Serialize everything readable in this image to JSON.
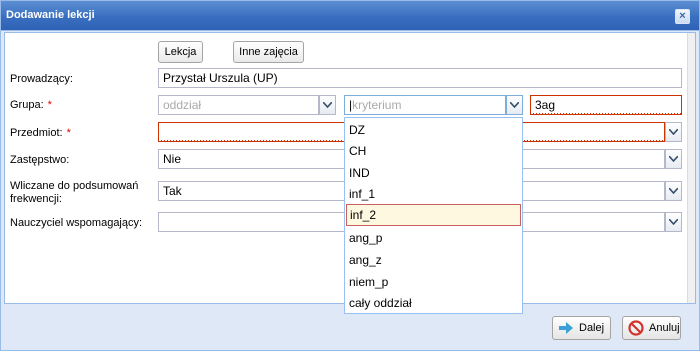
{
  "window": {
    "title": "Dodawanie lekcji",
    "close_glyph": "×"
  },
  "tabs": [
    {
      "label": "Lekcja"
    },
    {
      "label": "Inne zajęcia"
    }
  ],
  "form": {
    "prowadzacy": {
      "label": "Prowadzący:",
      "value": "Przystał Urszula (UP)"
    },
    "grupa": {
      "label": "Grupa:",
      "required": "*",
      "oddzial_placeholder": "oddział",
      "kryterium_placeholder": "kryterium",
      "value": "3ag"
    },
    "przedmiot": {
      "label": "Przedmiot:",
      "required": "*",
      "value": ""
    },
    "zastepstwo": {
      "label": "Zastępstwo:",
      "value": "Nie"
    },
    "frekwencja": {
      "label_line1": "Wliczane do podsumowań",
      "label_line2": "frekwencji:",
      "value": "Tak"
    },
    "wspomagajacy": {
      "label": "Nauczyciel wspomagający:",
      "value": ""
    }
  },
  "dropdown": {
    "items": [
      "DZ",
      "CH",
      "IND",
      "inf_1",
      "inf_2",
      "ang_p",
      "ang_z",
      "niem_p",
      "cały oddział"
    ],
    "selected": "inf_2"
  },
  "footer": {
    "next_label": "Dalej",
    "cancel_label": "Anuluj"
  },
  "colors": {
    "title_bar": "#3a6fc0",
    "invalid": "#cc3300",
    "selected_item_bg": "#fff8e0"
  }
}
